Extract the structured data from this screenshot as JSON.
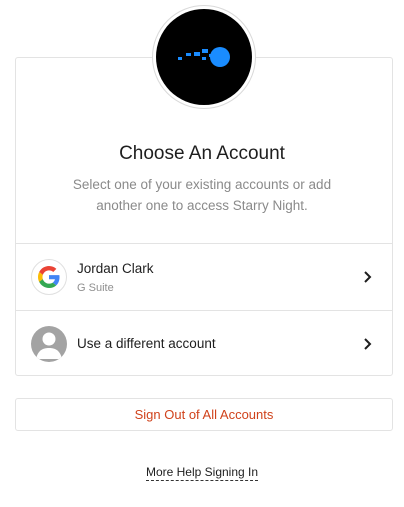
{
  "header": {
    "logo_icon": "starry-night-logo",
    "title": "Choose An Account",
    "subtitle": "Select one of your existing accounts or add another one to access Starry Night."
  },
  "accounts": [
    {
      "name": "Jordan Clark",
      "provider": "G Suite",
      "icon": "google-icon"
    }
  ],
  "different_account": {
    "label": "Use a different account",
    "icon": "user-avatar-icon"
  },
  "actions": {
    "signout_label": "Sign Out of All Accounts",
    "help_label": "More Help Signing In"
  },
  "colors": {
    "signout_text": "#d0421b",
    "logo_blue": "#1a8cff",
    "logo_bg": "#000000"
  }
}
